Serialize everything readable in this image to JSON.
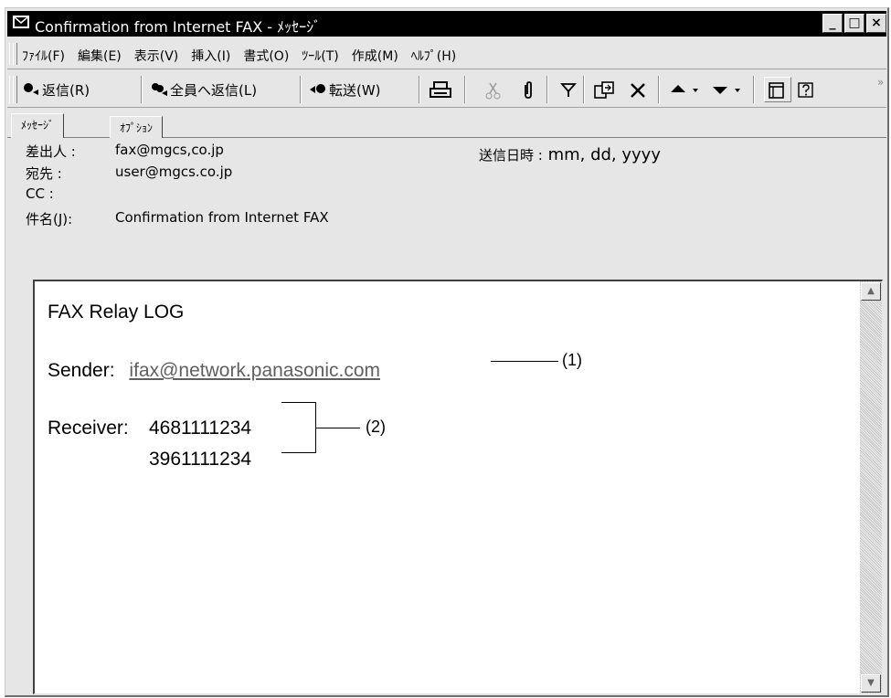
{
  "window": {
    "title": "Confirmation from Internet FAX - ﾒｯｾｰｼﾞ",
    "controls": {
      "minimize": "_",
      "maximize": "□",
      "close": "×"
    }
  },
  "menu": {
    "items": [
      "ﾌｧｲﾙ(F)",
      "編集(E)",
      "表示(V)",
      "挿入(I)",
      "書式(O)",
      "ﾂｰﾙ(T)",
      "作成(M)",
      "ﾍﾙﾌﾟ(H)"
    ]
  },
  "toolbar": {
    "reply": "返信(R)",
    "reply_all": "全員へ返信(L)",
    "forward": "転送(W)",
    "overflow": "»"
  },
  "tabs": [
    "ﾒｯｾｰｼﾞ",
    "ｵﾌﾟｼｮﾝ"
  ],
  "header": {
    "from_label": "差出人 :",
    "from_value": "fax@mgcs,co.jp",
    "to_label": "宛先 :",
    "to_value": "user@mgcs.co.jp",
    "cc_label": "CC :",
    "cc_value": "",
    "subject_label": "件名(J):",
    "subject_value": "Confirmation from Internet FAX",
    "date_label": "送信日時 :",
    "date_value": "mm, dd, yyyy"
  },
  "body": {
    "title": "FAX Relay LOG",
    "sender_label": "Sender:",
    "sender_value": "ifax@network.panasonic.com",
    "receiver_label": "Receiver:",
    "receivers": [
      "4681111234",
      "3961111234"
    ]
  },
  "callouts": {
    "one": "(1)",
    "two": "(2)"
  },
  "colors": {
    "titlebar": "#000000",
    "chrome": "#e6e6e6",
    "link": "#606060"
  },
  "icons": [
    "mail-icon",
    "reply-icon",
    "reply-all-icon",
    "forward-icon",
    "print-icon",
    "cut-icon",
    "attach-icon",
    "flag-icon",
    "copy-icon",
    "delete-icon",
    "previous-icon",
    "next-icon",
    "address-book-icon",
    "help-icon"
  ]
}
